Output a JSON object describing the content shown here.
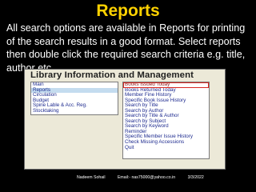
{
  "slide": {
    "title": "Reports",
    "description": "All search options are available in Reports for printing of the search results in a good format. Select reports then double click the required search criteria e.g. title, author etc."
  },
  "app": {
    "title": "Library Information and Management System",
    "main_menu": [
      {
        "label": "Main"
      },
      {
        "label": "Reports",
        "selected": true
      },
      {
        "label": "Circulation"
      },
      {
        "label": "Budget"
      },
      {
        "label": "Spine Lable & Acc. Reg."
      },
      {
        "label": "Stocktaking"
      }
    ],
    "report_menu": [
      {
        "label": "Books Issued Today",
        "highlighted": true
      },
      {
        "label": "Books Returned Today"
      },
      {
        "label": "Member Fine History"
      },
      {
        "label": "Specific Book Issue History"
      },
      {
        "label": "Search by Title"
      },
      {
        "label": "Search by Author"
      },
      {
        "label": "Search by Title & Author"
      },
      {
        "label": "Search by Subject"
      },
      {
        "label": "Search by Keyword"
      },
      {
        "label": "Reminder"
      },
      {
        "label": "Specific Member Issue History"
      },
      {
        "label": "Check Missing Accessions"
      },
      {
        "label": "Quit"
      }
    ]
  },
  "footer": {
    "author": "Nadeem Sohail",
    "email": "Email:- nas75000@yahoo.co.in",
    "date": "3/3/2022"
  },
  "colors": {
    "slide_background": "#000000",
    "title": "#ffd200",
    "menu_text": "#1e2b8f",
    "selection": "#c4dcef",
    "highlight_box": "#d9261f"
  }
}
